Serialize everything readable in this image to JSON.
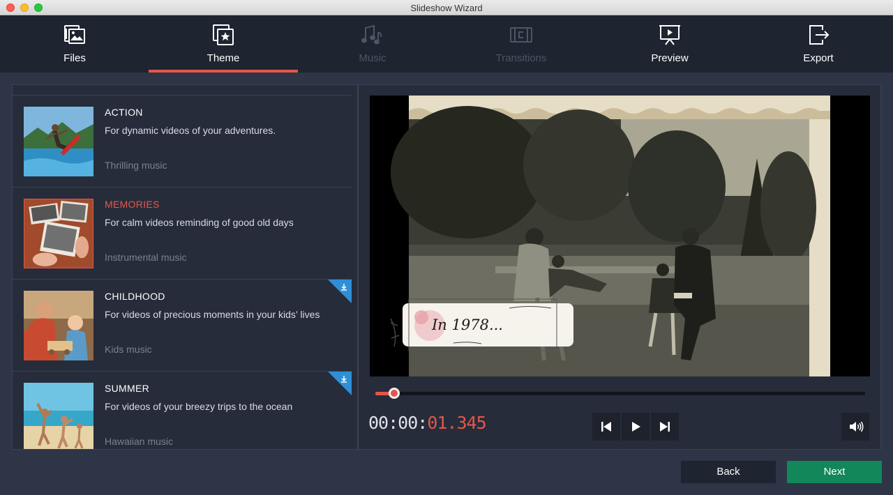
{
  "window": {
    "title": "Slideshow Wizard"
  },
  "toolbar": {
    "tabs": [
      {
        "label": "Files",
        "icon": "files-icon",
        "state": "enabled"
      },
      {
        "label": "Theme",
        "icon": "theme-icon",
        "state": "active"
      },
      {
        "label": "Music",
        "icon": "music-icon",
        "state": "disabled"
      },
      {
        "label": "Transitions",
        "icon": "transitions-icon",
        "state": "disabled"
      },
      {
        "label": "Preview",
        "icon": "preview-icon",
        "state": "enabled"
      },
      {
        "label": "Export",
        "icon": "export-icon",
        "state": "enabled"
      }
    ]
  },
  "themes": [
    {
      "title": "ACTION",
      "description": "For dynamic videos of your adventures.",
      "music": "Thrilling music",
      "selected": false,
      "downloadable": false
    },
    {
      "title": "MEMORIES",
      "description": "For calm videos reminding of good old days",
      "music": "Instrumental music",
      "selected": true,
      "downloadable": false
    },
    {
      "title": "CHILDHOOD",
      "description": "For videos of precious moments in your kids’ lives",
      "music": "Kids music",
      "selected": false,
      "downloadable": true
    },
    {
      "title": "SUMMER",
      "description": "For videos of your breezy trips to the ocean",
      "music": "Hawaiian music",
      "selected": false,
      "downloadable": true
    }
  ],
  "preview": {
    "caption": "In 1978...",
    "timecode_prefix": "00:00:",
    "timecode_value": "01.345",
    "progress_fraction": 0.037
  },
  "footer": {
    "back_label": "Back",
    "next_label": "Next"
  },
  "colors": {
    "accent": "#e5564a",
    "next_button": "#12875a",
    "background": "#2e3546",
    "toolbar": "#1e2430"
  }
}
